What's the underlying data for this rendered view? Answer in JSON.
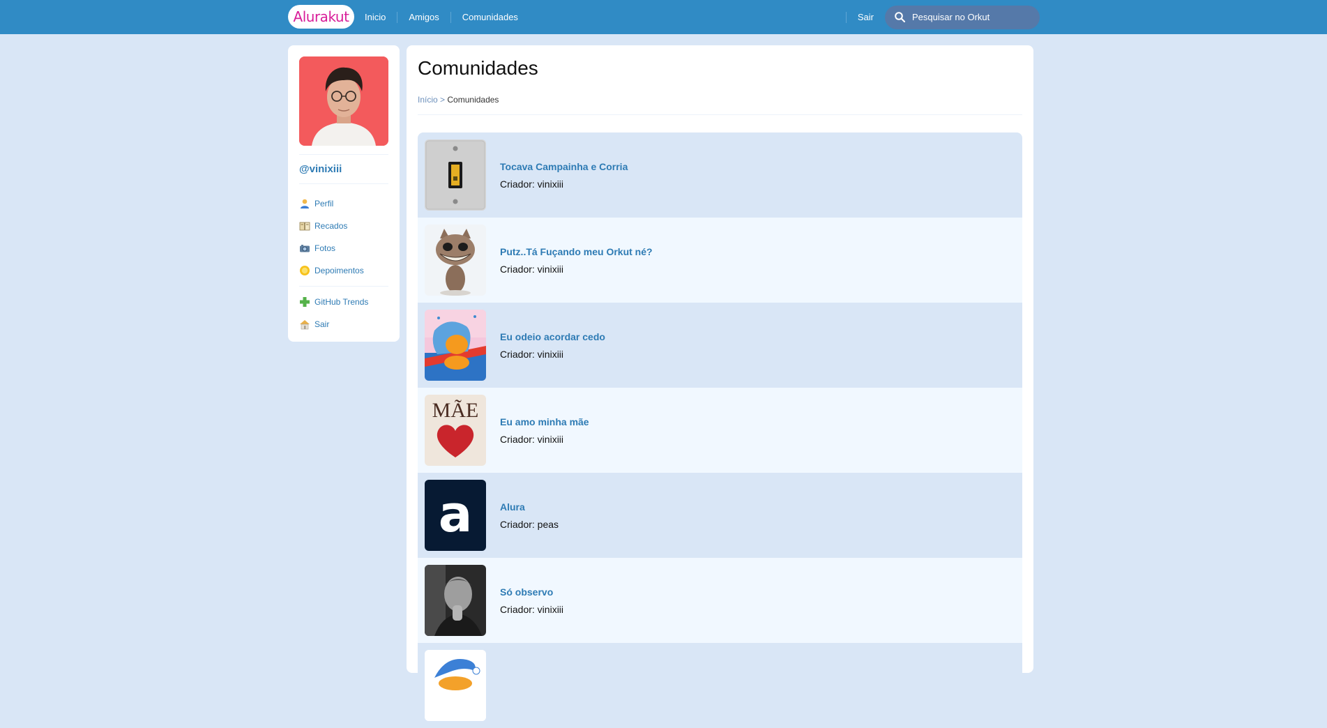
{
  "header": {
    "logo": "Alurakut",
    "nav": [
      "Inicio",
      "Amigos",
      "Comunidades"
    ],
    "logout": "Sair",
    "search_placeholder": "Pesquisar no Orkut"
  },
  "sidebar": {
    "username": "@vinixiii",
    "menu": [
      {
        "label": "Perfil",
        "icon": "user-icon"
      },
      {
        "label": "Recados",
        "icon": "book-icon"
      },
      {
        "label": "Fotos",
        "icon": "camera-icon"
      },
      {
        "label": "Depoimentos",
        "icon": "sun-icon"
      }
    ],
    "menu2": [
      {
        "label": "GitHub Trends",
        "icon": "plus-icon"
      },
      {
        "label": "Sair",
        "icon": "home-icon"
      }
    ]
  },
  "main": {
    "title": "Comunidades",
    "breadcrumb": {
      "home": "Início",
      "sep": ">",
      "current": "Comunidades"
    },
    "communities": [
      {
        "name": "Tocava Campainha e Corria",
        "creator": "Criador: vinixiii"
      },
      {
        "name": "Putz..Tá Fuçando meu Orkut né?",
        "creator": "Criador: vinixiii"
      },
      {
        "name": "Eu odeio acordar cedo",
        "creator": "Criador: vinixiii"
      },
      {
        "name": "Eu amo minha mãe",
        "creator": "Criador: vinixiii"
      },
      {
        "name": "Alura",
        "creator": "Criador: peas"
      },
      {
        "name": "Só observo",
        "creator": "Criador: vinixiii"
      },
      {
        "name": "",
        "creator": ""
      }
    ],
    "thumb_text": {
      "mae": "MÃE",
      "alura": "a"
    }
  },
  "colors": {
    "topbar": "#308BC5",
    "background": "#D9E6F6",
    "link": "#2E7BB4",
    "logo": "#D81D99"
  }
}
